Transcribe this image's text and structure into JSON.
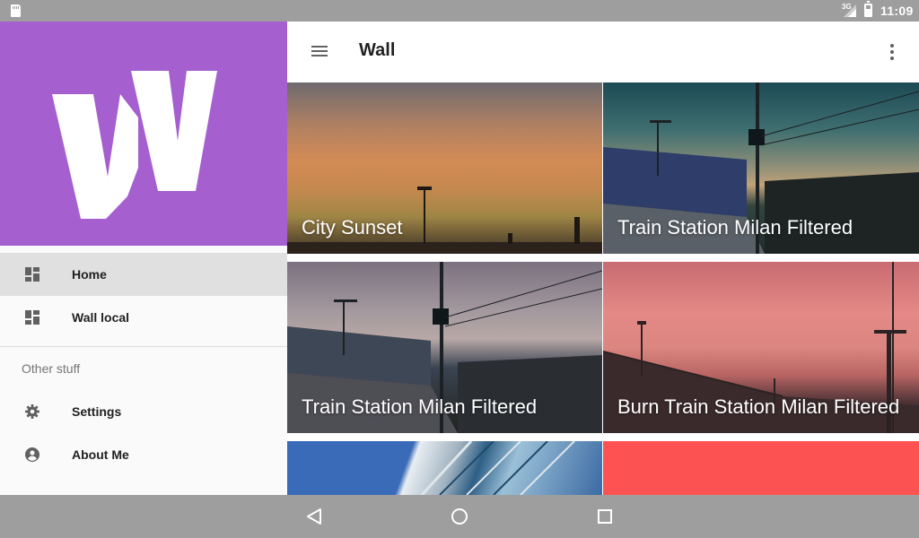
{
  "status_bar": {
    "network": "3G",
    "time": "11:09",
    "icons": [
      "sd-card-icon",
      "signal-icon",
      "battery-icon"
    ]
  },
  "drawer": {
    "header_color": "#a55fcf",
    "logo": "wall-logo",
    "items": [
      {
        "label": "Home",
        "icon": "dashboard-icon",
        "active": true
      },
      {
        "label": "Wall local",
        "icon": "dashboard-icon",
        "active": false
      }
    ],
    "subheader": "Other stuff",
    "other_items": [
      {
        "label": "Settings",
        "icon": "gear-icon"
      },
      {
        "label": "About Me",
        "icon": "account-circle-icon"
      }
    ]
  },
  "app_bar": {
    "title": "Wall",
    "menu_icon": "hamburger-menu-icon",
    "overflow_icon": "more-vert-icon"
  },
  "wallpapers": [
    {
      "title": "City Sunset"
    },
    {
      "title": "Train Station Milan Filtered"
    },
    {
      "title": "Train Station Milan Filtered"
    },
    {
      "title": "Burn Train Station Milan Filtered"
    },
    {
      "title": ""
    },
    {
      "title": ""
    }
  ],
  "nav_bar": {
    "buttons": [
      "back-icon",
      "home-icon",
      "recents-icon"
    ]
  },
  "colors": {
    "accent": "#a55fcf",
    "status_bar": "#9e9e9e",
    "active_item": "#e0e0e0",
    "coral_tile": "#fc5352"
  }
}
